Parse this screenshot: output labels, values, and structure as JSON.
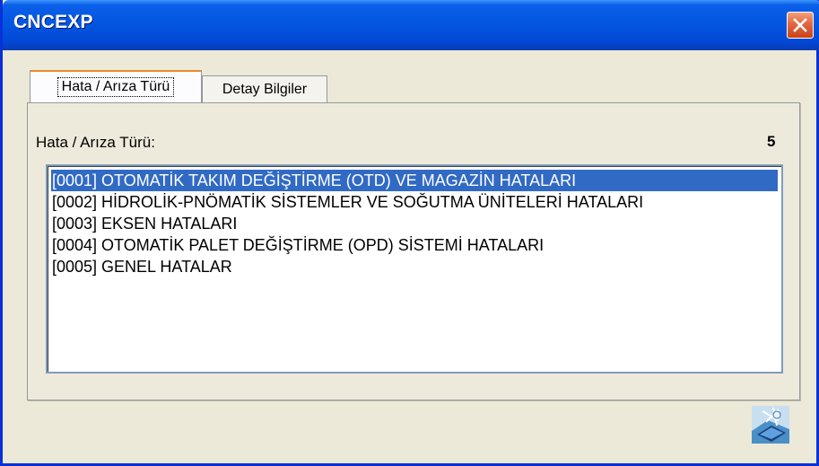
{
  "window": {
    "title": "CNCEXP"
  },
  "tabs": [
    {
      "label": "Hata / Arıza Türü",
      "active": true
    },
    {
      "label": "Detay Bilgiler",
      "active": false
    }
  ],
  "panel": {
    "label": "Hata / Arıza Türü:",
    "count": "5"
  },
  "list": {
    "items": [
      {
        "text": "[0001] OTOMATİK TAKIM DEĞİŞTİRME (OTD) VE MAGAZİN HATALARI",
        "selected": true
      },
      {
        "text": "[0002] HİDROLİK-PNÖMATİK SİSTEMLER VE SOĞUTMA ÜNİTELERİ HATALARI",
        "selected": false
      },
      {
        "text": "[0003] EKSEN HATALARI",
        "selected": false
      },
      {
        "text": "[0004] OTOMATİK PALET DEĞİŞTİRME (OPD) SİSTEMİ HATALARI",
        "selected": false
      },
      {
        "text": "[0005] GENEL HATALAR",
        "selected": false
      }
    ]
  },
  "colors": {
    "titlebar": "#0355e0",
    "selection": "#316ac5",
    "close": "#e1673f"
  },
  "icons": {
    "close": "close-icon",
    "corner": "computer-network-icon"
  }
}
